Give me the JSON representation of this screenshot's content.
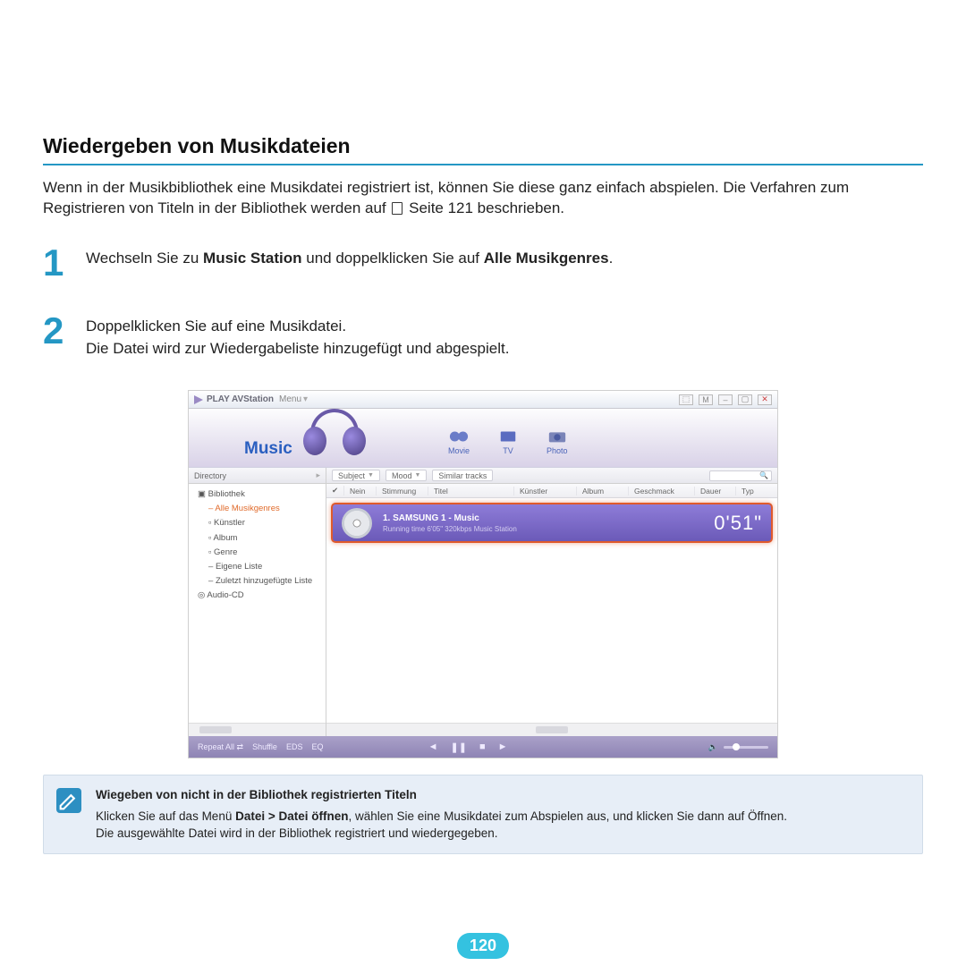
{
  "section_title": "Wiedergeben von Musikdateien",
  "intro_a": "Wenn in der Musikbibliothek eine Musikdatei registriert ist, können Sie diese ganz einfach abspielen. Die Verfahren zum Registrieren von Titeln in der Bibliothek werden auf ",
  "intro_b": " Seite 121 beschrieben.",
  "steps": {
    "s1_num": "1",
    "s1_a": "Wechseln Sie zu ",
    "s1_b": "Music Station",
    "s1_c": " und doppelklicken Sie auf ",
    "s1_d": "Alle Musikgenres",
    "s1_e": ".",
    "s2_num": "2",
    "s2_line1": "Doppelklicken Sie auf eine Musikdatei.",
    "s2_line2": "Die Datei wird zur Wiedergabeliste hinzugefügt und abgespielt."
  },
  "app": {
    "title": "PLAY AVStation",
    "menu": "Menu",
    "win": {
      "b1": "⬚",
      "b2": "M",
      "b3": "–",
      "b4": "▢",
      "b5": "✕"
    },
    "music": "Music",
    "tabs": {
      "movie": "Movie",
      "tv": "TV",
      "photo": "Photo"
    },
    "directory": "Directory",
    "tree": {
      "root": "Bibliothek",
      "i1": "Alle Musikgenres",
      "i2": "Künstler",
      "i3": "Album",
      "i4": "Genre",
      "i5": "Eigene Liste",
      "i6": "Zuletzt hinzugefügte Liste",
      "i7": "Audio-CD"
    },
    "filters": {
      "subject": "Subject",
      "mood": "Mood",
      "similar": "Similar tracks"
    },
    "cols": {
      "c0": "",
      "c1": "Nein",
      "c2": "Stimmung",
      "c3": "Titel",
      "c4": "Künstler",
      "c5": "Album",
      "c6": "Geschmack",
      "c7": "Dauer",
      "c8": "Typ"
    },
    "np": {
      "title": "1.  SAMSUNG 1 - Music",
      "sub": "Running time 6'05\"     320kbps     Music Station",
      "time": "0'51\""
    },
    "pb": {
      "repeat": "Repeat All",
      "shuffle": "Shuffle",
      "eds": "EDS",
      "eq": "EQ"
    }
  },
  "note": {
    "title": "Wiegeben von nicht in der Bibliothek registrierten Titeln",
    "l1a": "Klicken Sie auf das Menü ",
    "l1b": "Datei > Datei öffnen",
    "l1c": ", wählen Sie eine Musikdatei zum Abspielen aus, und klicken Sie dann auf Öffnen.",
    "l2": "Die ausgewählte Datei wird in der Bibliothek registriert und wiedergegeben."
  },
  "page_number": "120"
}
